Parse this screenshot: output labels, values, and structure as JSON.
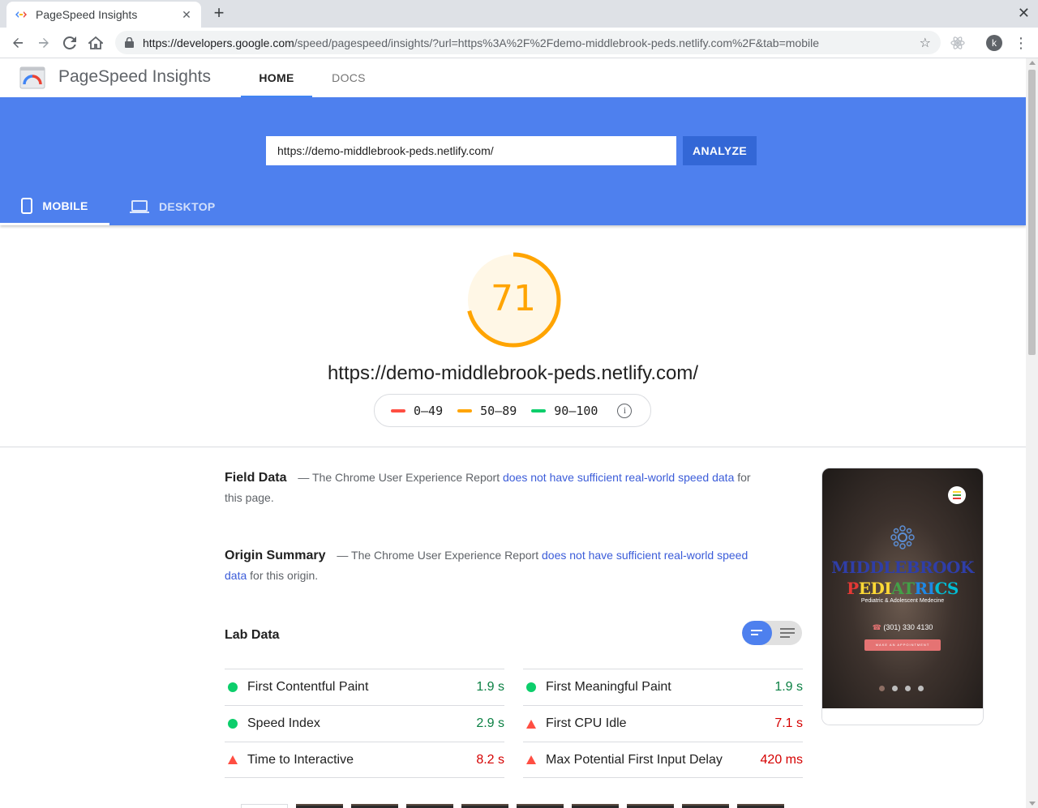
{
  "browser": {
    "tab_title": "PageSpeed Insights",
    "url_host": "https://developers.google.com",
    "url_path": "/speed/pagespeed/insights/?url=https%3A%2F%2Fdemo-middlebrook-peds.netlify.com%2F&tab=mobile",
    "avatar_letter": "k"
  },
  "header": {
    "title": "PageSpeed Insights",
    "nav": [
      "HOME",
      "DOCS"
    ]
  },
  "hero": {
    "input_value": "https://demo-middlebrook-peds.netlify.com/",
    "analyze_label": "ANALYZE",
    "tabs": [
      "MOBILE",
      "DESKTOP"
    ]
  },
  "score": {
    "value": "71",
    "fraction": 0.71,
    "color": "#ffa400",
    "tested_url": "https://demo-middlebrook-peds.netlify.com/",
    "legend": [
      {
        "label": "0–49",
        "color": "#ff4e42"
      },
      {
        "label": "50–89",
        "color": "#ffa400"
      },
      {
        "label": "90–100",
        "color": "#0cce6b"
      }
    ]
  },
  "field_data": {
    "heading": "Field Data",
    "prefix": "— The Chrome User Experience Report",
    "link": "does not have sufficient real-world speed data",
    "suffix": "for this page."
  },
  "origin_summary": {
    "heading": "Origin Summary",
    "prefix": "— The Chrome User Experience Report",
    "link": "does not have sufficient real-world speed data",
    "suffix": "for this origin."
  },
  "lab_data": {
    "heading": "Lab Data",
    "left": [
      {
        "label": "First Contentful Paint",
        "value": "1.9 s",
        "status": "pass"
      },
      {
        "label": "Speed Index",
        "value": "2.9 s",
        "status": "pass"
      },
      {
        "label": "Time to Interactive",
        "value": "8.2 s",
        "status": "fail"
      }
    ],
    "right": [
      {
        "label": "First Meaningful Paint",
        "value": "1.9 s",
        "status": "pass"
      },
      {
        "label": "First CPU Idle",
        "value": "7.1 s",
        "status": "fail"
      },
      {
        "label": "Max Potential First Input Delay",
        "value": "420 ms",
        "status": "fail"
      }
    ]
  },
  "screenshot": {
    "brand_line1": "MIDDLEBROOK",
    "brand_line2": "PEDIATRICS",
    "subtitle": "Pediatric & Adolescent Medecine",
    "phone": "(301) 330 4130",
    "cta": "MAKE AN APPOINTMENT"
  }
}
